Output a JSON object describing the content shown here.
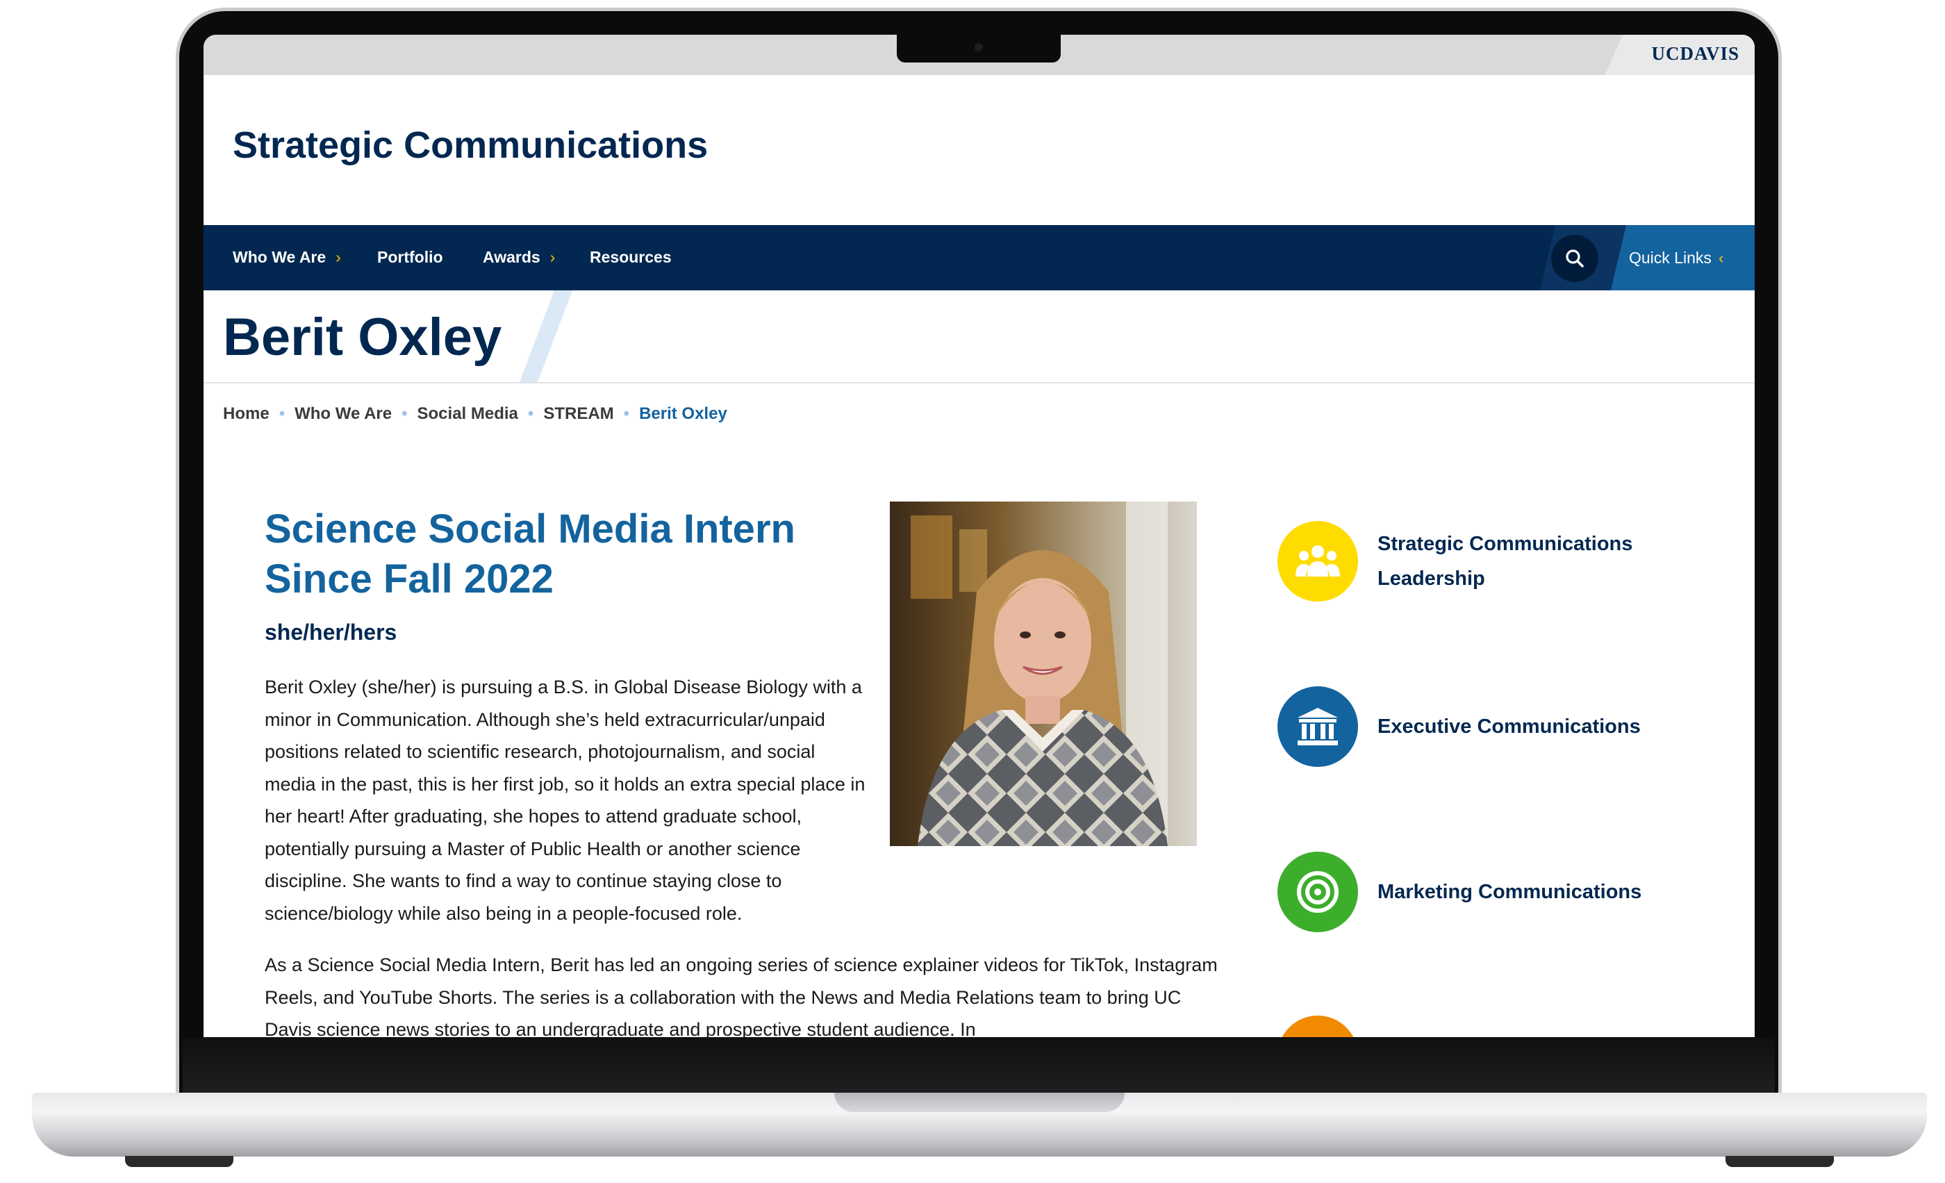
{
  "brand": {
    "logo_text": "UCDAVIS"
  },
  "site": {
    "title": "Strategic Communications"
  },
  "nav": {
    "items": [
      {
        "label": "Who We Are",
        "has_submenu": true
      },
      {
        "label": "Portfolio",
        "has_submenu": false
      },
      {
        "label": "Awards",
        "has_submenu": true
      },
      {
        "label": "Resources",
        "has_submenu": false
      }
    ],
    "quick_links": "Quick Links"
  },
  "page": {
    "title": "Berit Oxley"
  },
  "breadcrumb": [
    "Home",
    "Who We Are",
    "Social Media",
    "STREAM",
    "Berit Oxley"
  ],
  "profile": {
    "role_line1": "Science Social Media Intern",
    "role_line2": "Since Fall 2022",
    "pronouns": "she/her/hers",
    "bio_p1": "Berit Oxley (she/her) is pursuing a B.S. in Global Disease Biology with a minor in Communication. Although she’s held extracurricular/unpaid positions related to scientific research, photojournalism, and social media in the past, this is her first job, so it holds an extra special place in her heart! After graduating, she hopes to attend graduate school, potentially pursuing a Master of Public Health or another science discipline. She wants to find a way to continue staying close to science/biology while also being in a people-focused role.",
    "bio_p2": "As a Science Social Media Intern, Berit has led an ongoing series of science explainer videos for TikTok, Instagram Reels, and YouTube Shorts. The series is a collaboration with the News and Media Relations team to bring UC Davis science news stories to an undergraduate and prospective student audience. In"
  },
  "sidebar": {
    "items": [
      {
        "label": "Strategic Communications Leadership",
        "icon": "people-group-icon",
        "color": "#ffdc00"
      },
      {
        "label": "Executive Communications",
        "icon": "institution-icon",
        "color": "#13639e"
      },
      {
        "label": "Marketing Communications",
        "icon": "target-icon",
        "color": "#3dae2b"
      },
      {
        "label": "",
        "icon": "partial-icon",
        "color": "#f18a00"
      }
    ]
  },
  "colors": {
    "navy": "#022851",
    "blue": "#13639e",
    "gold": "#ffbf00"
  }
}
